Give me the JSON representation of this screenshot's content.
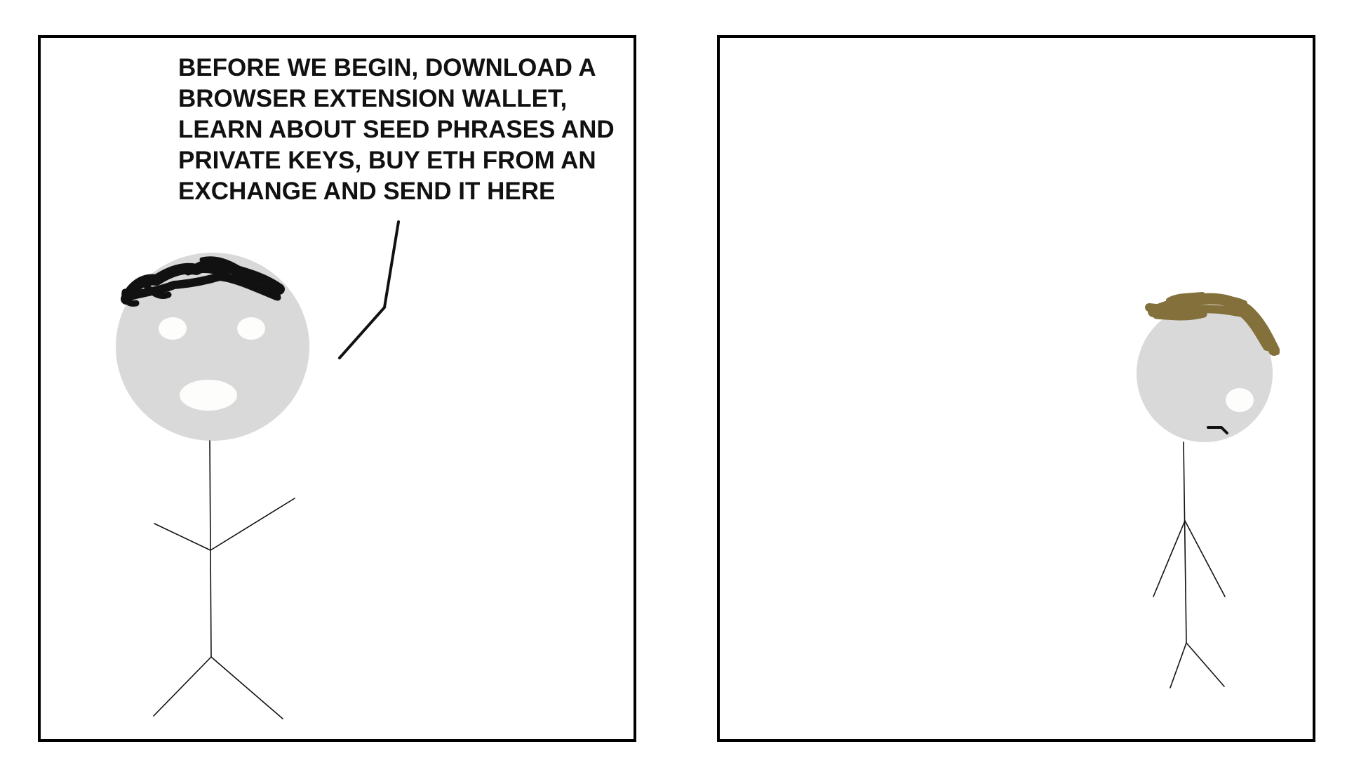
{
  "comic": {
    "panel1": {
      "speech_text": "BEFORE WE BEGIN, DOWNLOAD A\nBROWSER EXTENSION WALLET,\nLEARN ABOUT SEED PHRASES AND\nPRIVATE KEYS, BUY ETH FROM AN\nEXCHANGE AND SEND IT HERE"
    },
    "colors": {
      "border": "#000000",
      "head": "#d9d9d9",
      "face_features": "#fdfdfb",
      "hair_speaker": "#111111",
      "hair_listener": "#83703a",
      "line": "#111111"
    }
  }
}
